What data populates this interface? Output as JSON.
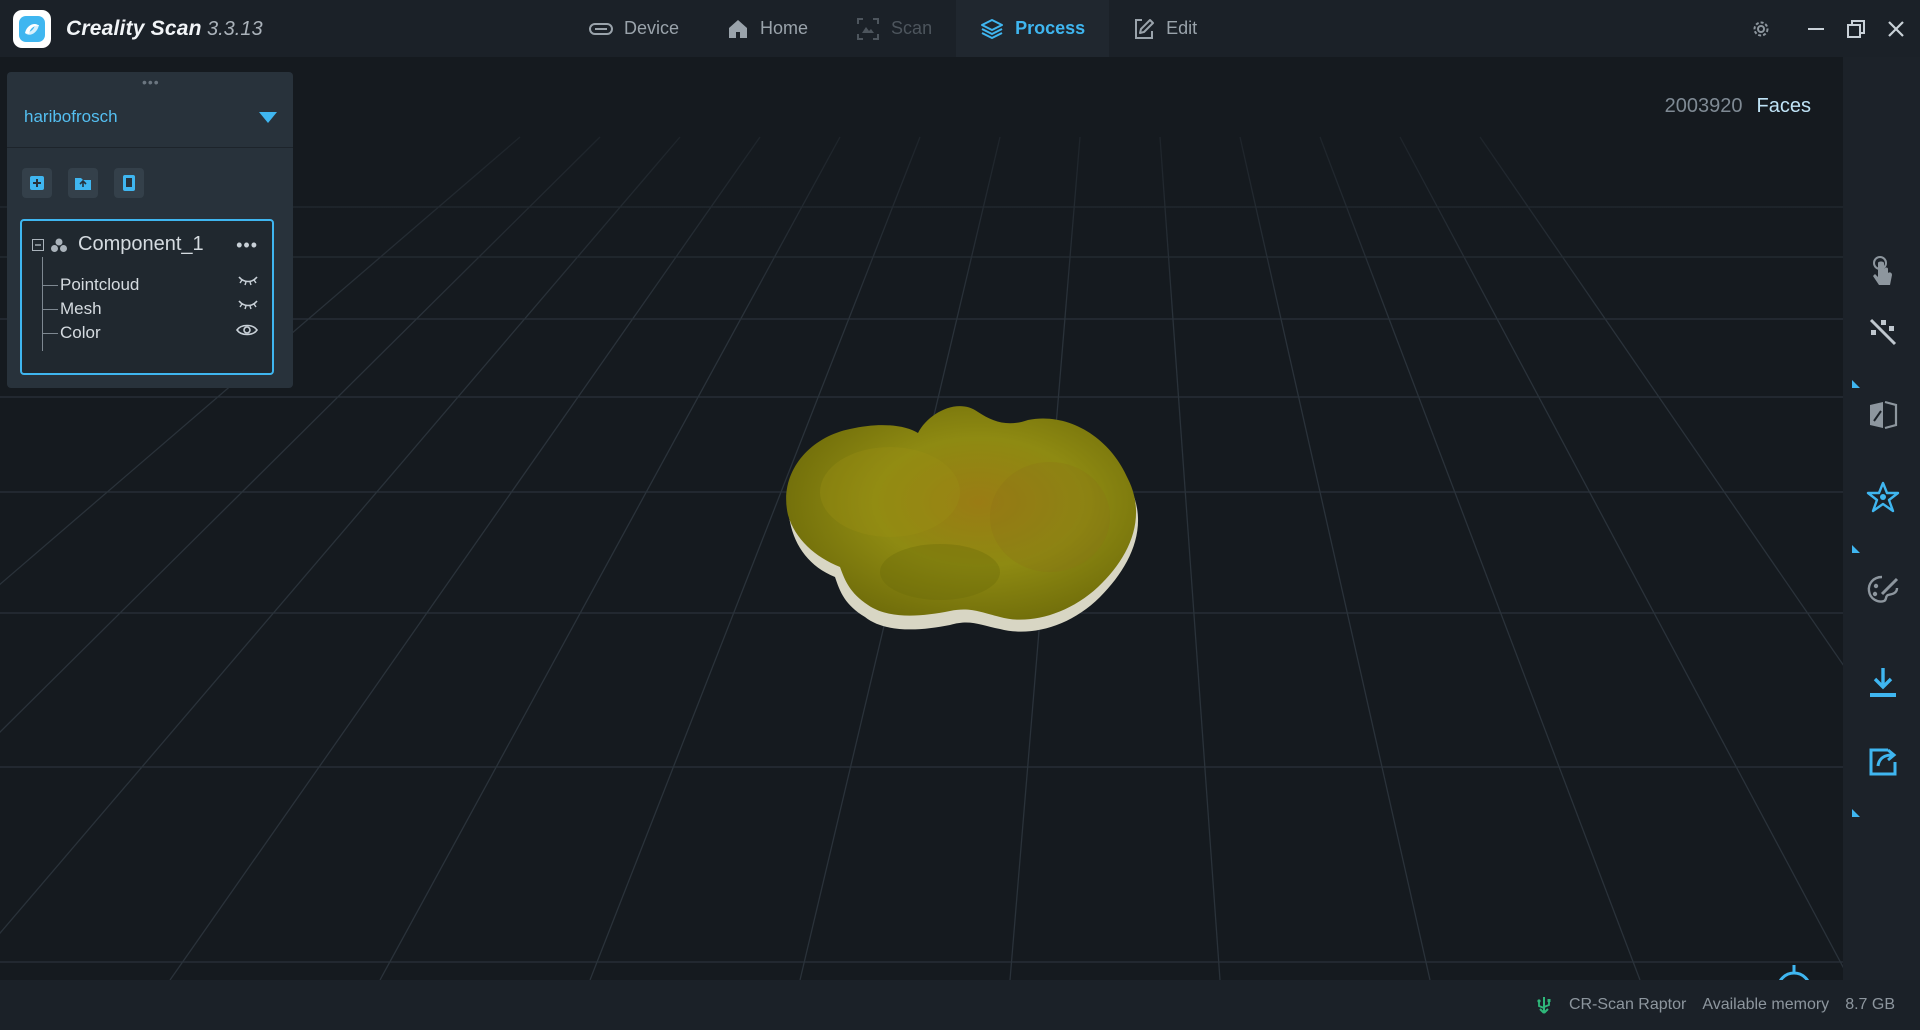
{
  "app": {
    "title": "Creality Scan",
    "version": "3.3.13",
    "brand_color": "#3fb6f0"
  },
  "nav": {
    "tabs": [
      {
        "label": "Device",
        "icon": "device-icon",
        "state": "normal"
      },
      {
        "label": "Home",
        "icon": "home-icon",
        "state": "normal"
      },
      {
        "label": "Scan",
        "icon": "scan-icon",
        "state": "disabled"
      },
      {
        "label": "Process",
        "icon": "layers-icon",
        "state": "active"
      },
      {
        "label": "Edit",
        "icon": "edit-icon",
        "state": "normal"
      }
    ]
  },
  "window_controls": [
    "settings-icon",
    "minimize-icon",
    "restore-icon",
    "close-icon"
  ],
  "project": {
    "name": "haribofrosch",
    "tools": [
      "add-project-icon",
      "open-folder-icon",
      "project-info-icon"
    ],
    "tree": {
      "root": "Component_1",
      "more": "•••",
      "children": [
        {
          "label": "Pointcloud",
          "visibility": "hidden"
        },
        {
          "label": "Mesh",
          "visibility": "hidden"
        },
        {
          "label": "Color",
          "visibility": "visible"
        }
      ]
    }
  },
  "viewport": {
    "face_count": "2003920",
    "face_label": "Faces",
    "model_color": "#8c8a12"
  },
  "right_toolbar": {
    "tools": [
      "touch-icon",
      "point-tool-icon",
      "mesh-split-icon",
      "network-icon",
      "texture-palette-icon",
      "download-icon",
      "export-share-icon"
    ]
  },
  "status": {
    "device": "CR-Scan Raptor",
    "memory_label": "Available memory",
    "memory_value": "8.7 GB"
  }
}
